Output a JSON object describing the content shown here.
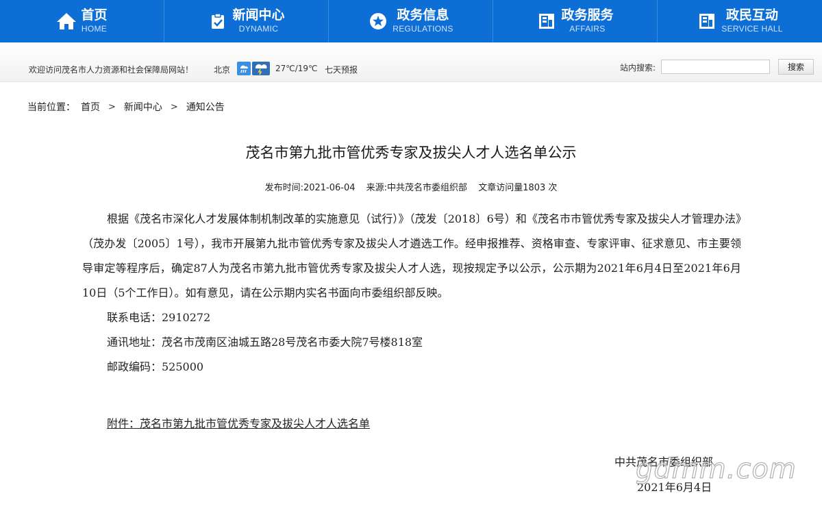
{
  "nav": {
    "items": [
      {
        "cn": "首页",
        "en": "HOME",
        "icon": "home-icon"
      },
      {
        "cn": "新闻中心",
        "en": "DYNAMIC",
        "icon": "clipboard-icon"
      },
      {
        "cn": "政务信息",
        "en": "REGULATIONS",
        "icon": "star-icon"
      },
      {
        "cn": "政务服务",
        "en": "AFFAIRS",
        "icon": "building-icon"
      },
      {
        "cn": "政民互动",
        "en": "SERVICE HALL",
        "icon": "building-icon"
      }
    ]
  },
  "infobar": {
    "welcome": "欢迎访问茂名市人力资源和社会保障局网站！",
    "city": "北京",
    "temperature": "27℃/19℃",
    "forecast": "七天预报",
    "search_label": "站内搜索:",
    "search_value": "",
    "search_button": "搜索"
  },
  "breadcrumb": {
    "label": "当前位置：",
    "items": [
      "首页",
      "新闻中心",
      "通知公告"
    ]
  },
  "article": {
    "title": "茂名市第九批市管优秀专家及拔尖人才人选名单公示",
    "publish_time": "发布时间:2021-06-04",
    "source": "来源:中共茂名市委组织部",
    "visits": "文章访问量1803 次",
    "paragraph": "根据《茂名市深化人才发展体制机制改革的实施意见（试行）》（茂发〔2018〕6号）和《茂名市市管优秀专家及拔尖人才管理办法》（茂办发〔2005〕1号），我市开展第九批市管优秀专家及拔尖人才遴选工作。经申报推荐、资格审查、专家评审、征求意见、市主要领导审定等程序后，确定87人为茂名市第九批市管优秀专家及拔尖人才人选，现按规定予以公示，公示期为2021年6月4日至2021年6月10日（5个工作日）。如有意见，请在公示期内实名书面向市委组织部反映。",
    "phone": "联系电话：2910272",
    "address": "通讯地址：茂名市茂南区油城五路28号茂名市委大院7号楼818室",
    "postcode": "邮政编码：525000",
    "attachment": "附件：茂名市第九批市管优秀专家及拔尖人才人选名单",
    "sign_org": "中共茂名市委组织部",
    "sign_date": "2021年6月4日"
  },
  "watermark": "gdmm.com",
  "colors": {
    "nav_bg": "#0d6fd6",
    "nav_en_text": "#cfe3fa"
  }
}
